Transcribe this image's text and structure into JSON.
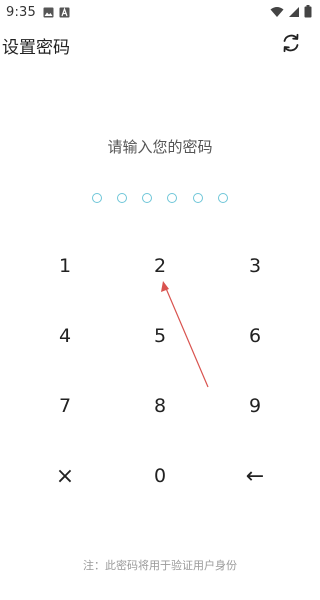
{
  "status_bar": {
    "time": "9:35",
    "left_icons": [
      "image-icon",
      "text-a-icon"
    ],
    "right_icons": [
      "wifi-icon",
      "cellular-signal-icon",
      "battery-icon"
    ]
  },
  "header": {
    "title": "设置密码",
    "action_icon": "refresh-icon"
  },
  "prompt": "请输入您的密码",
  "pin": {
    "length": 6,
    "filled": 0,
    "dot_color": "#6ec6d8"
  },
  "keypad": {
    "rows": [
      [
        "1",
        "2",
        "3"
      ],
      [
        "4",
        "5",
        "6"
      ],
      [
        "7",
        "8",
        "9"
      ],
      [
        "×",
        "0",
        "←"
      ]
    ]
  },
  "note": "注：此密码将用于验证用户身份",
  "annotation": {
    "arrow_color": "#d9534f"
  }
}
